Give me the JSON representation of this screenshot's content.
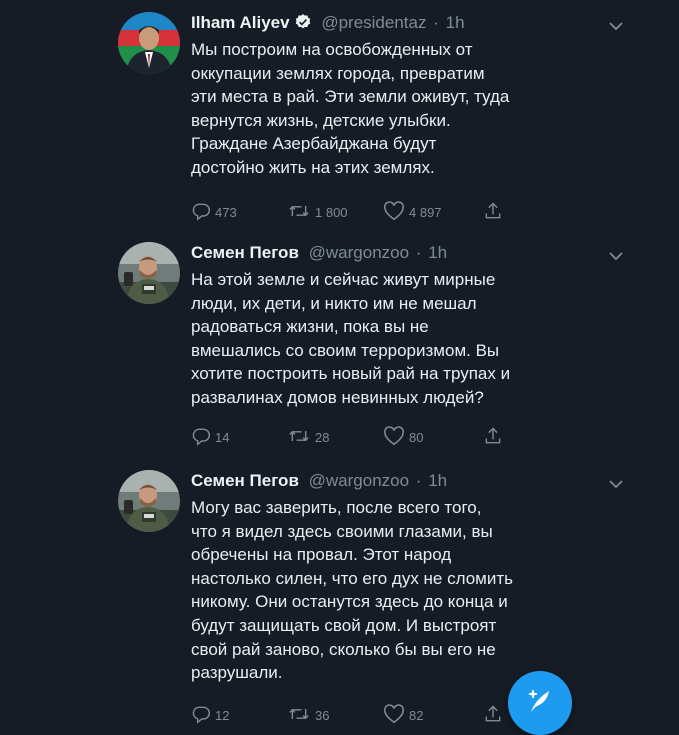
{
  "tweets": [
    {
      "name": "Ilham Aliyev",
      "verified": true,
      "handle": "@presidentaz",
      "separator": "·",
      "time": "1h",
      "text_lines": [
        "Мы построим на освобожденных от",
        "оккупации землях города, превратим",
        "эти места в рай. Эти земли оживут, туда",
        "вернутся жизнь, детские улыбки.",
        "Граждане Азербайджана будут",
        "достойно жить на этих землях."
      ],
      "replies": "473",
      "retweets": "1 800",
      "likes": "4 897"
    },
    {
      "name": "Семен Пегов",
      "verified": false,
      "handle": "@wargonzoo",
      "separator": "·",
      "time": "1h",
      "text_lines": [
        "На этой земле и сейчас живут мирные",
        "люди, их дети, и никто им не мешал",
        "радоваться жизни, пока вы не",
        "вмешались со своим терроризмом. Вы",
        "хотите построить новый рай на трупах и",
        "развалинах домов невинных людей?"
      ],
      "replies": "14",
      "retweets": "28",
      "likes": "80"
    },
    {
      "name": "Семен Пегов",
      "verified": false,
      "handle": "@wargonzoo",
      "separator": "·",
      "time": "1h",
      "text_lines": [
        "Могу вас заверить, после всего того,",
        "что я видел здесь своими глазами, вы",
        "обречены на провал. Этот народ",
        "настолько силен, что его дух не сломить",
        "никому. Они останутся здесь до конца и",
        "будут защищать свой дом. И выстроят",
        "свой рай заново, сколько бы вы его не",
        "разрушали."
      ],
      "replies": "12",
      "retweets": "36",
      "likes": "82"
    }
  ],
  "icons": {
    "reply": "reply-icon",
    "retweet": "retweet-icon",
    "like": "heart-icon",
    "share": "share-icon",
    "menu": "chevron-down-icon",
    "verified": "verified-badge-icon",
    "compose": "compose-tweet-icon"
  },
  "colors": {
    "background": "#151c25",
    "text": "#e9eef2",
    "muted": "#7f8b97",
    "accent": "#1d9bf0"
  }
}
